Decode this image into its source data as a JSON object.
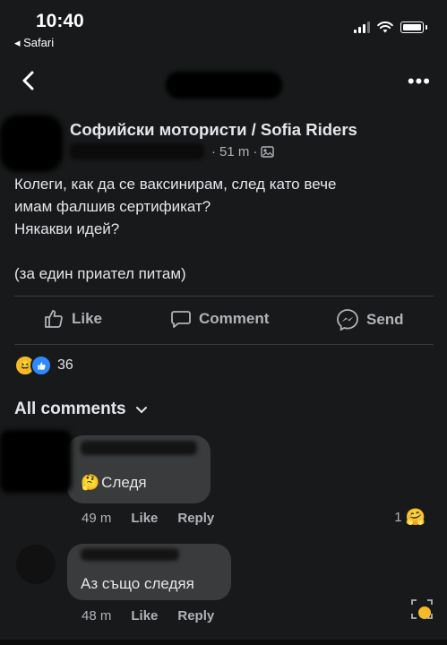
{
  "status_bar": {
    "time": "10:40",
    "back_app": "◂ Safari"
  },
  "post": {
    "group_name": "Софийски мотористи / Sofia Riders",
    "time": "51 m",
    "text_lines": [
      "Колеги, как да се ваксинирам, след като вече",
      "имам фалшив сертификат?",
      "Някакви идей?",
      "",
      "(за един приател питам)"
    ],
    "actions": {
      "like": "Like",
      "comment": "Comment",
      "send": "Send"
    },
    "reaction_count": "36"
  },
  "comments_section": {
    "filter_label": "All comments",
    "comments": [
      {
        "emoji": "🤔",
        "text": "Следя",
        "time": "49 m",
        "like": "Like",
        "reply": "Reply",
        "reaction_count": "1"
      },
      {
        "text": "Аз също следяя",
        "time": "48 m",
        "like": "Like",
        "reply": "Reply"
      }
    ]
  },
  "colors": {
    "background": "#18191a",
    "bubble": "#3a3b3c",
    "secondary_text": "#b0b3b8",
    "like_blue": "#2e89ff"
  }
}
